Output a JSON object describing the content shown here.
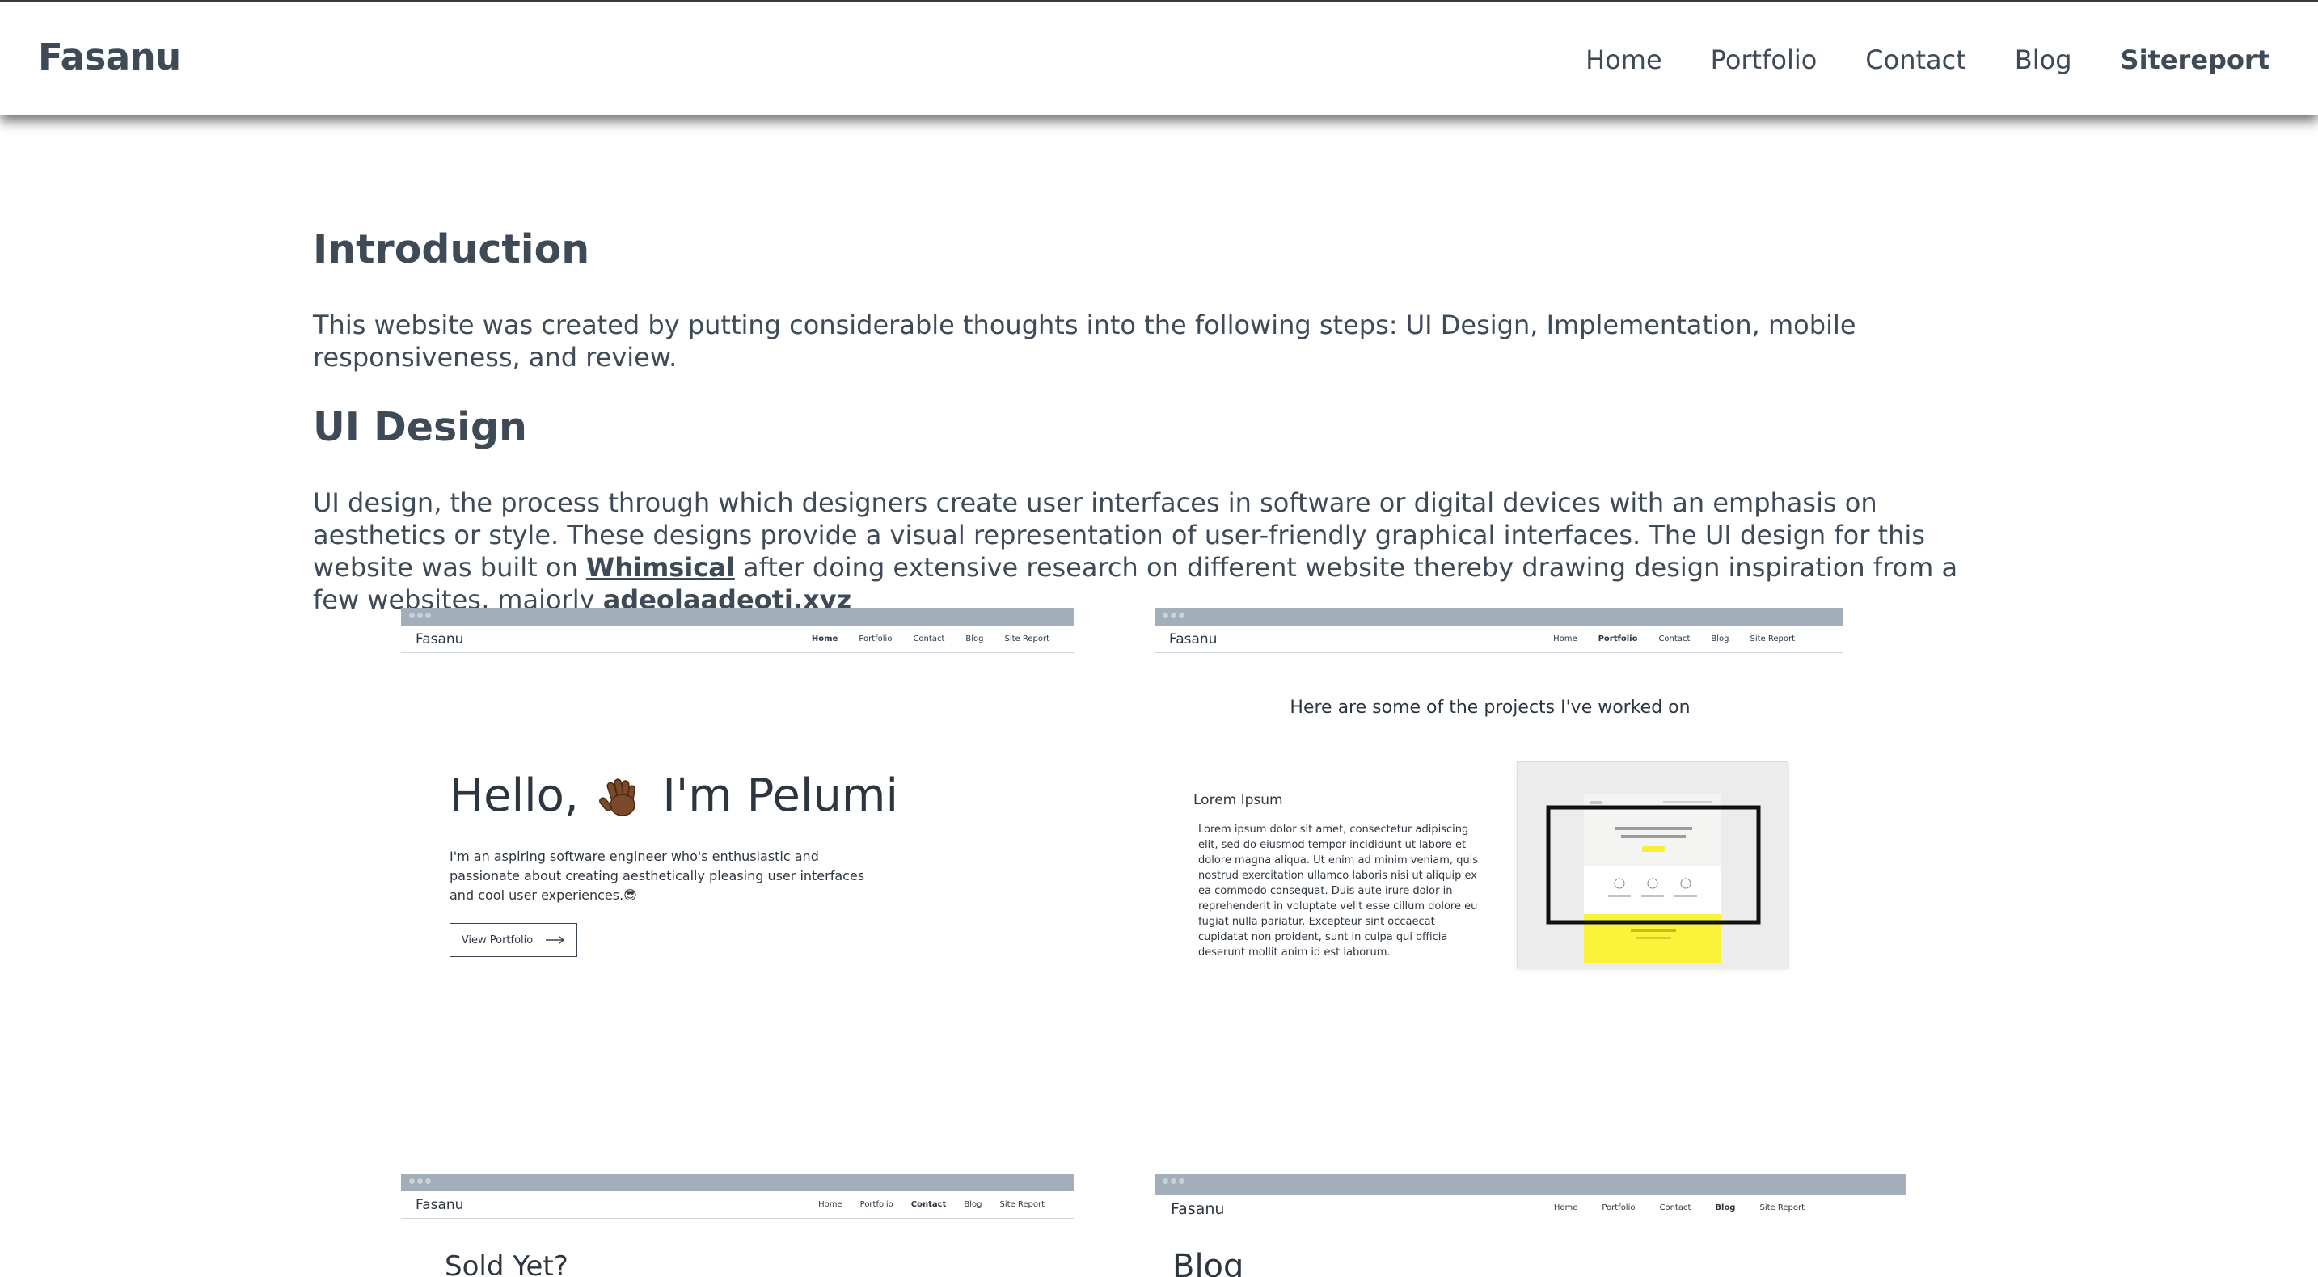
{
  "header": {
    "brand": "Fasanu",
    "nav": [
      "Home",
      "Portfolio",
      "Contact",
      "Blog",
      "Sitereport"
    ],
    "active": "Sitereport"
  },
  "intro": {
    "heading": "Introduction",
    "text": "This website was created by putting considerable thoughts into the following steps: UI Design, Implementation, mobile responsiveness, and review."
  },
  "ui_design": {
    "heading": "UI Design",
    "text_1": "UI design, the process through which designers create user interfaces in software or digital devices with an emphasis on aesthetics or style. These designs provide a visual representation of user-friendly graphical interfaces. The UI design for this website was built on ",
    "link_1": "Whimsical",
    "text_2": " after doing extensive research on different website thereby drawing design inspiration from a few websites, majorly ",
    "link_2": "adeolaadeoti.xyz"
  },
  "mockups": {
    "home": {
      "brand": "Fasanu",
      "nav": [
        "Home",
        "Portfolio",
        "Contact",
        "Blog",
        "Site Report"
      ],
      "hello_before": "Hello,",
      "hello_after": "I'm Pelumi",
      "intro": "I'm an aspiring software engineer who's enthusiastic and passionate about creating aesthetically pleasing user interfaces and cool user experiences.😎",
      "button": "View Portfolio",
      "button_icon": "arrow-right-icon"
    },
    "portfolio": {
      "brand": "Fasanu",
      "nav": [
        "Home",
        "Portfolio",
        "Contact",
        "Blog",
        "Site Report"
      ],
      "title": "Here are some of the projects I've worked on",
      "project_title": "Lorem Ipsum",
      "project_text": "Lorem ipsum dolor sit amet, consectetur adipiscing elit, sed do eiusmod tempor incididunt ut labore et dolore magna aliqua. Ut enim ad minim veniam, quis nostrud exercitation ullamco laboris nisi ut aliquip ex ea commodo consequat. Duis aute irure dolor in reprehenderit in voluptate velit esse cillum dolore eu fugiat nulla pariatur. Excepteur sint occaecat cupidatat non proident, sunt in culpa qui officia deserunt mollit anim id est laborum."
    },
    "contact": {
      "brand": "Fasanu",
      "nav": [
        "Home",
        "Portfolio",
        "Contact",
        "Blog",
        "Site Report"
      ],
      "heading": "Sold Yet?"
    },
    "blog": {
      "brand": "Fasanu",
      "nav": [
        "Home",
        "Portfolio",
        "Contact",
        "Blog",
        "Site Report"
      ],
      "heading": "Blog"
    }
  }
}
